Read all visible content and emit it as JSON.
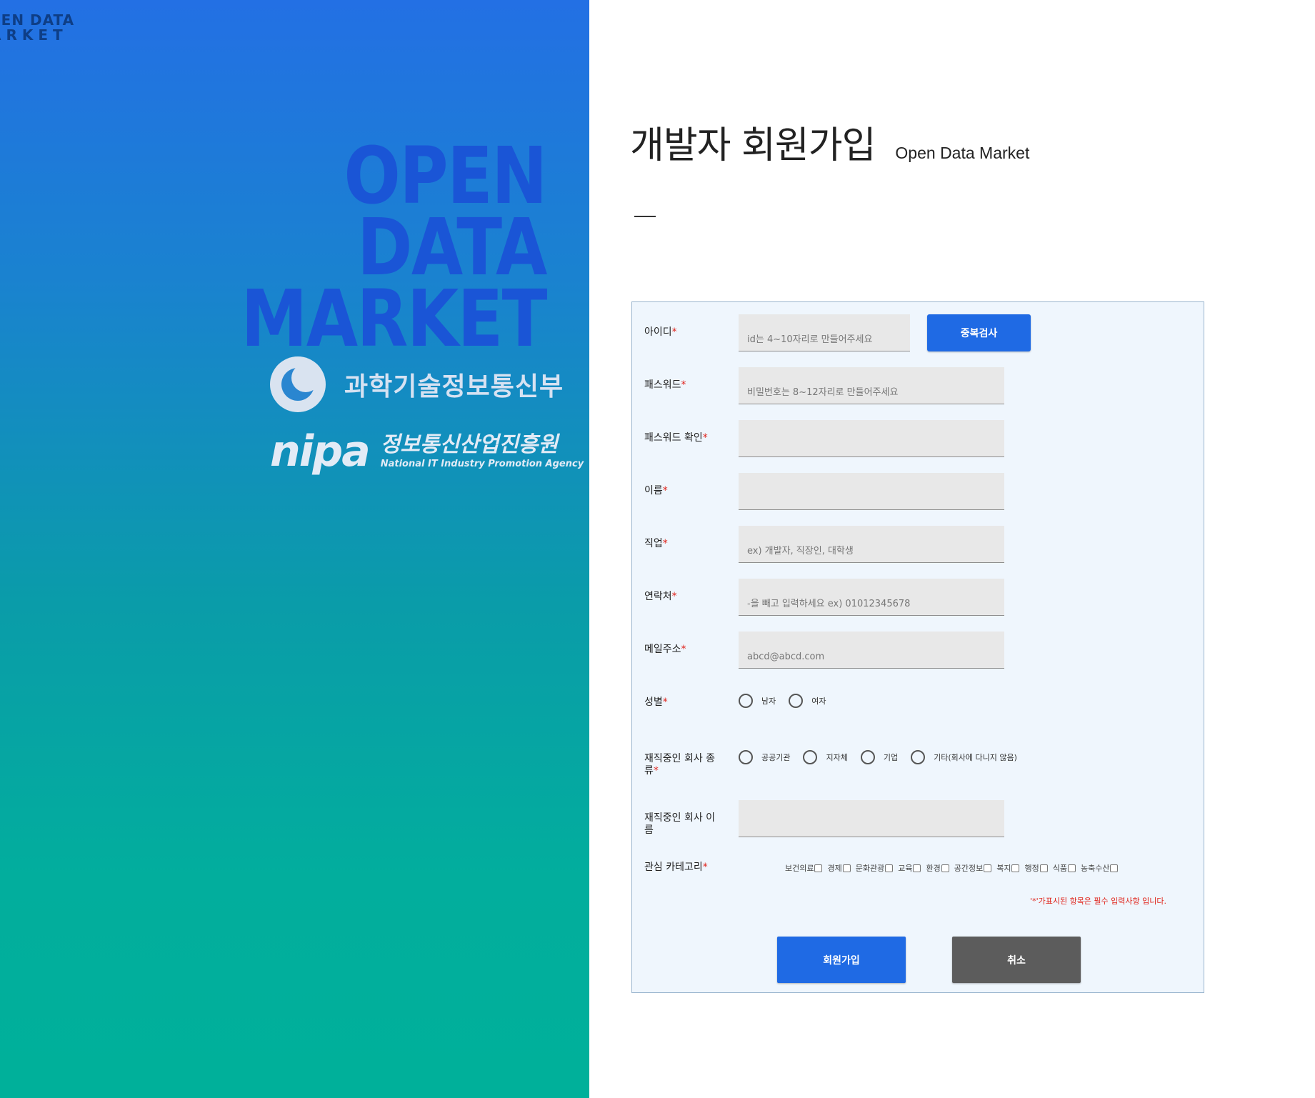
{
  "branding": {
    "corner_logo_line1": "PEN DATA",
    "corner_logo_line2": "ARKET",
    "big_logo_lines": [
      "OPEN",
      "DATA",
      "MARKET"
    ],
    "ministry_name": "과학기술정보통신부",
    "nipa_mark": "nipa",
    "nipa_korean": "정보통신산업진흥원",
    "nipa_english": "National IT Industry Promotion Agency"
  },
  "header": {
    "title": "개발자 회원가입",
    "subtitle": "Open Data Market"
  },
  "form": {
    "required_mark": "*",
    "id": {
      "label": "아이디",
      "placeholder": "id는 4~10자리로 만들어주세요",
      "value": ""
    },
    "dup_check_label": "중복검사",
    "password": {
      "label": "패스워드",
      "placeholder": "비밀번호는 8~12자리로 만들어주세요",
      "value": ""
    },
    "password_confirm": {
      "label": "패스워드 확인",
      "placeholder": "",
      "value": ""
    },
    "name": {
      "label": "이름",
      "placeholder": "",
      "value": ""
    },
    "job": {
      "label": "직업",
      "placeholder": "ex) 개발자, 직장인, 대학생",
      "value": ""
    },
    "phone": {
      "label": "연락처",
      "placeholder": "-을 빼고 입력하세요 ex) 01012345678",
      "value": ""
    },
    "email": {
      "label": "메일주소",
      "placeholder": "abcd@abcd.com",
      "value": ""
    },
    "gender": {
      "label": "성별",
      "options": [
        "남자",
        "여자"
      ]
    },
    "company_type": {
      "label_line1": "재직중인 회사 종",
      "label_line2": "류",
      "options": [
        "공공기관",
        "지자체",
        "기업",
        "기타(회사에 다니지 않음)"
      ]
    },
    "company_name": {
      "label_line1": "재직중인 회사 이",
      "label_line2": "름",
      "placeholder": "",
      "value": ""
    },
    "interest": {
      "label": "관심 카테고리",
      "categories": [
        "보건의료",
        "경제",
        "문화관광",
        "교육",
        "환경",
        "공간정보",
        "복지",
        "행정",
        "식품",
        "농축수산"
      ]
    },
    "notice": "'*'가표시된 항목은 필수 입력사항 입니다.",
    "submit_label": "회원가입",
    "cancel_label": "취소"
  },
  "colors": {
    "accent": "#1f6ae4",
    "required": "#e0241c",
    "cancel": "#5c5c5c"
  }
}
